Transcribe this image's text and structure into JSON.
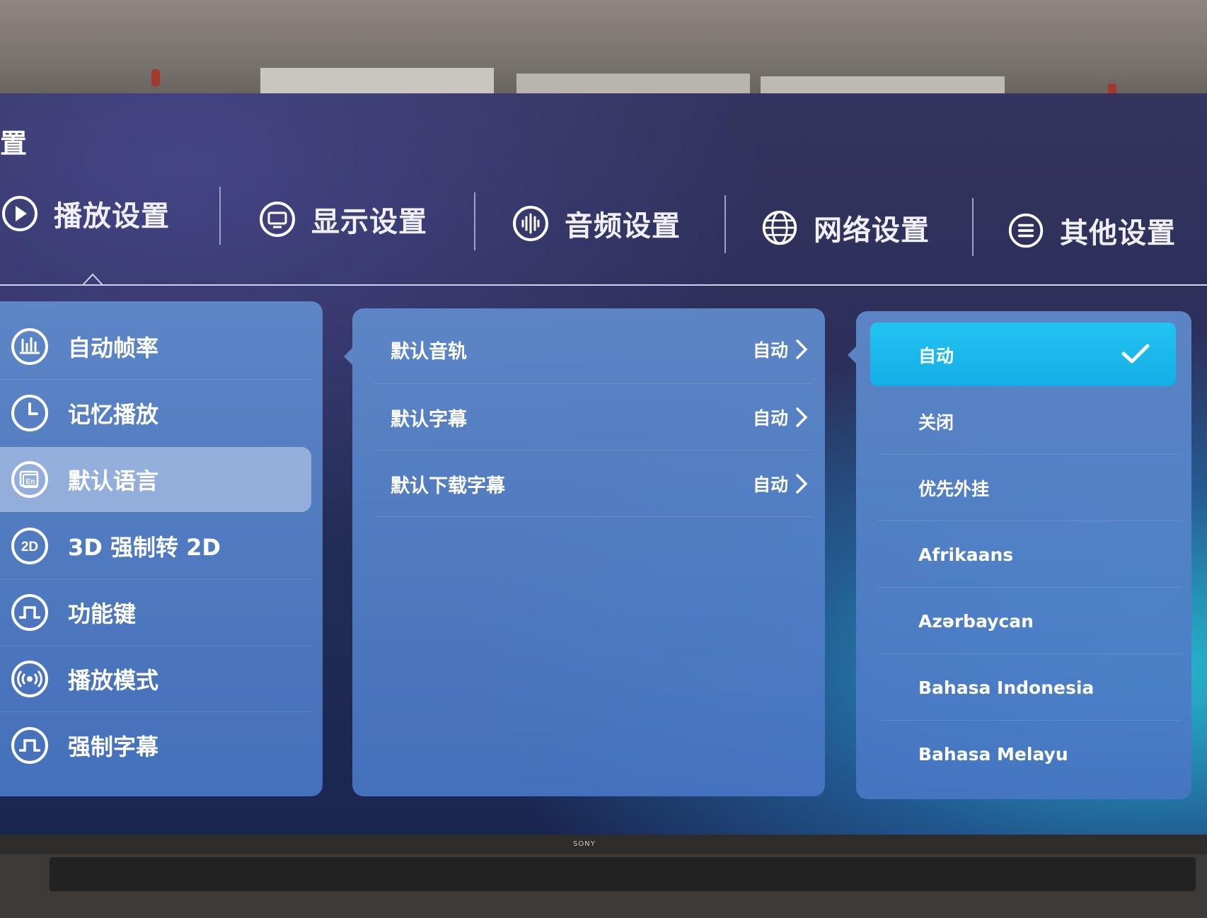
{
  "page_title": "置",
  "tabs": [
    {
      "label": "播放设置",
      "icon": "play-circle-icon",
      "active": true
    },
    {
      "label": "显示设置",
      "icon": "monitor-icon"
    },
    {
      "label": "音频设置",
      "icon": "audio-wave-icon"
    },
    {
      "label": "网络设置",
      "icon": "globe-icon"
    },
    {
      "label": "其他设置",
      "icon": "menu-circle-icon"
    }
  ],
  "sidebar": {
    "items": [
      {
        "label": "自动帧率",
        "icon": "frame-rate-icon"
      },
      {
        "label": "记忆播放",
        "icon": "clock-icon"
      },
      {
        "label": "默认语言",
        "icon": "language-icon",
        "selected": true
      },
      {
        "label": "3D 强制转 2D",
        "icon": "2d-icon"
      },
      {
        "label": "功能键",
        "icon": "pulse-icon"
      },
      {
        "label": "播放模式",
        "icon": "broadcast-icon"
      },
      {
        "label": "强制字幕",
        "icon": "pulse-icon"
      }
    ]
  },
  "middle": {
    "items": [
      {
        "label": "默认音轨",
        "value": "自动"
      },
      {
        "label": "默认字幕",
        "value": "自动"
      },
      {
        "label": "默认下载字幕",
        "value": "自动"
      }
    ]
  },
  "options": {
    "selected": "自动",
    "items": [
      "自动",
      "关闭",
      "优先外挂",
      "Afrikaans",
      "Azərbaycan",
      "Bahasa Indonesia",
      "Bahasa Melayu"
    ]
  },
  "brand": "SONY",
  "colors": {
    "accent": "#1bb8ec",
    "panel": "#5b86c8",
    "text": "#ffffff"
  }
}
